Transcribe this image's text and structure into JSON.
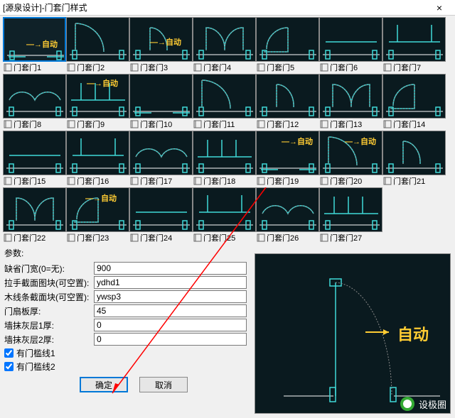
{
  "window": {
    "title": "[源泉设计]-门套门样式",
    "close": "×"
  },
  "styles": [
    {
      "label": "门套门1",
      "auto": true,
      "autoPos": "right:10px;top:28px",
      "sel": true
    },
    {
      "label": "门套门2",
      "auto": false
    },
    {
      "label": "门套门3",
      "auto": true,
      "autoPos": "left:28px;top:26px"
    },
    {
      "label": "门套门4",
      "auto": false
    },
    {
      "label": "门套门5",
      "auto": false
    },
    {
      "label": "门套门6",
      "auto": false
    },
    {
      "label": "门套门7",
      "auto": false
    },
    {
      "label": "门套门8",
      "auto": false
    },
    {
      "label": "门套门9",
      "auto": true,
      "autoPos": "left:28px;top:4px"
    },
    {
      "label": "门套门10",
      "auto": false
    },
    {
      "label": "门套门11",
      "auto": false
    },
    {
      "label": "门套门12",
      "auto": false
    },
    {
      "label": "门套门13",
      "auto": false
    },
    {
      "label": "门套门14",
      "auto": false
    },
    {
      "label": "门套门15",
      "auto": false
    },
    {
      "label": "门套门16",
      "auto": false
    },
    {
      "label": "门套门17",
      "auto": false
    },
    {
      "label": "门套门18",
      "auto": false
    },
    {
      "label": "门套门19",
      "auto": true,
      "autoPos": "right:8px;top:6px"
    },
    {
      "label": "门套门20",
      "auto": true,
      "autoPos": "right:8px;top:6px"
    },
    {
      "label": "门套门21",
      "auto": false
    },
    {
      "label": "门套门22",
      "auto": false
    },
    {
      "label": "门套门23",
      "auto": true,
      "autoPos": "left:26px;top:6px"
    },
    {
      "label": "门套门24",
      "auto": false
    },
    {
      "label": "门套门25",
      "auto": false
    },
    {
      "label": "门套门26",
      "auto": false
    },
    {
      "label": "门套门27",
      "auto": false
    }
  ],
  "params": {
    "header": "参数:",
    "width": {
      "label": "缺省门宽(0=无):",
      "value": "900"
    },
    "handle": {
      "label": "拉手截面图块(可空置):",
      "value": "ydhd1"
    },
    "frame": {
      "label": "木线条截面块(可空置):",
      "value": "ywsp3"
    },
    "leaf": {
      "label": "门扇板厚:",
      "value": "45"
    },
    "plaster1": {
      "label": "墙抹灰层1厚:",
      "value": "0"
    },
    "plaster2": {
      "label": "墙抹灰层2厚:",
      "value": "0"
    },
    "lintel1": {
      "label": "有门槛线1",
      "checked": true
    },
    "lintel2": {
      "label": "有门槛线2",
      "checked": true
    }
  },
  "buttons": {
    "ok": "确定",
    "cancel": "取消"
  },
  "preview": {
    "auto": "自动"
  },
  "watermark": "设极圈"
}
